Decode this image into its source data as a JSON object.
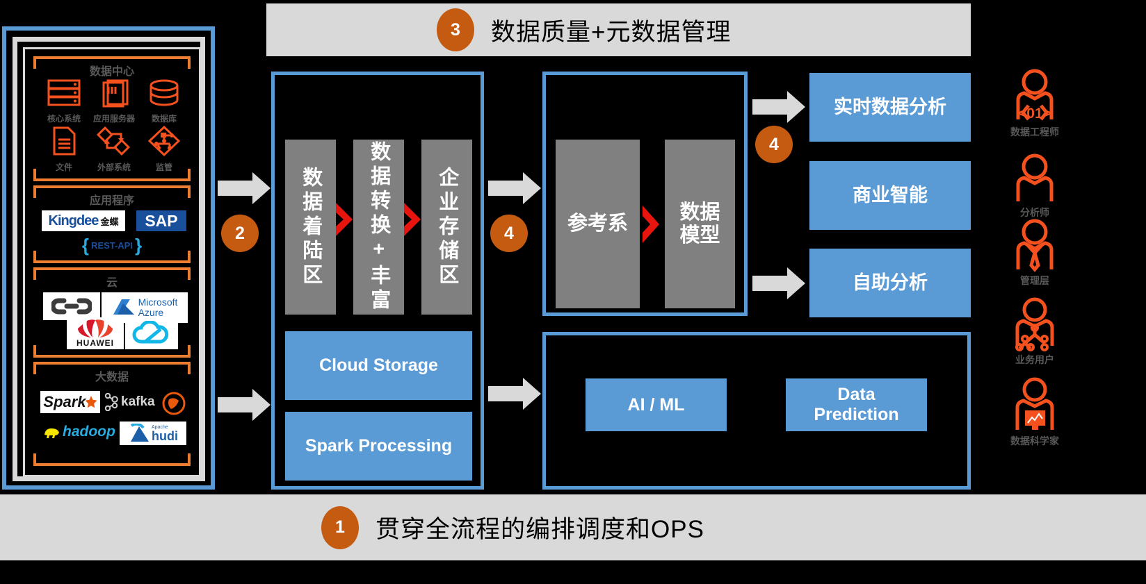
{
  "colors": {
    "accent_blue": "#5b9bd5",
    "accent_orange": "#ed7d31",
    "badge_orange": "#c55a11",
    "gray_box": "#808080",
    "banner_gray": "#d9d9d9",
    "chevron_red": "#e8150f",
    "arrow_gray": "#d9d9d9",
    "label_gray": "#595959",
    "background": "#000000"
  },
  "banners": {
    "top": {
      "number": "3",
      "text": "数据质量+元数据管理"
    },
    "bottom": {
      "number": "1",
      "text": "贯穿全流程的编排调度和OPS"
    }
  },
  "step_badges": [
    {
      "number": "2"
    },
    {
      "number": "4"
    },
    {
      "number": "4"
    }
  ],
  "sources": {
    "groups": [
      {
        "title": "数据中心",
        "items": [
          {
            "icon": "server-rack-icon",
            "label": "核心系统"
          },
          {
            "icon": "app-server-icon",
            "label": "应用服务器"
          },
          {
            "icon": "database-icon",
            "label": "数据库"
          },
          {
            "icon": "file-document-icon",
            "label": "文件"
          },
          {
            "icon": "external-system-flow-icon",
            "label": "外部系统"
          },
          {
            "icon": "regulation-network-icon",
            "label": "监管"
          }
        ]
      },
      {
        "title": "应用程序",
        "logos": [
          {
            "name": "kingdee-logo",
            "text": "Kingdee",
            "suffix": "金蝶"
          },
          {
            "name": "sap-logo",
            "text": "SAP"
          },
          {
            "name": "rest-api-logo",
            "text": "REST-API"
          }
        ]
      },
      {
        "title": "云",
        "logos": [
          {
            "name": "openshift-logo",
            "text": ""
          },
          {
            "name": "microsoft-azure-logo",
            "text": "Microsoft",
            "suffix": "Azure"
          },
          {
            "name": "huawei-logo",
            "text": "HUAWEI"
          },
          {
            "name": "tencent-cloud-logo",
            "text": ""
          }
        ]
      },
      {
        "title": "大数据",
        "logos": [
          {
            "name": "spark-logo",
            "text": "Spark"
          },
          {
            "name": "kafka-logo",
            "text": "kafka"
          },
          {
            "name": "flink-logo",
            "text": ""
          },
          {
            "name": "hadoop-logo",
            "text": "hadoop"
          },
          {
            "name": "apache-hudi-logo",
            "text": "hudi",
            "suffix": "Apache"
          }
        ]
      }
    ]
  },
  "pipeline": {
    "stages": [
      {
        "label": "数据着陆区"
      },
      {
        "label": "数据转换+丰富"
      },
      {
        "label": "企业存储区"
      }
    ],
    "platforms": [
      {
        "label": "Cloud Storage"
      },
      {
        "label": "Spark Processing"
      }
    ]
  },
  "modeling": {
    "stages": [
      {
        "label": "参考系"
      },
      {
        "label": "数据模型"
      }
    ]
  },
  "consumption": {
    "boxes": [
      {
        "label": "实时数据分析"
      },
      {
        "label": "商业智能"
      },
      {
        "label": "自助分析"
      }
    ]
  },
  "advanced": {
    "boxes": [
      {
        "label": "AI / ML"
      },
      {
        "label": "Data Prediction"
      }
    ]
  },
  "personas": [
    {
      "icon": "data-engineer-icon",
      "badge": "<01>",
      "label": "数据工程师"
    },
    {
      "icon": "analyst-icon",
      "badge": "",
      "label": "分析师"
    },
    {
      "icon": "manager-icon",
      "badge": "",
      "label": "管理层"
    },
    {
      "icon": "business-user-icon",
      "badge": "",
      "label": "业务用户"
    },
    {
      "icon": "data-scientist-icon",
      "badge": "",
      "label": "数据科学家"
    }
  ]
}
